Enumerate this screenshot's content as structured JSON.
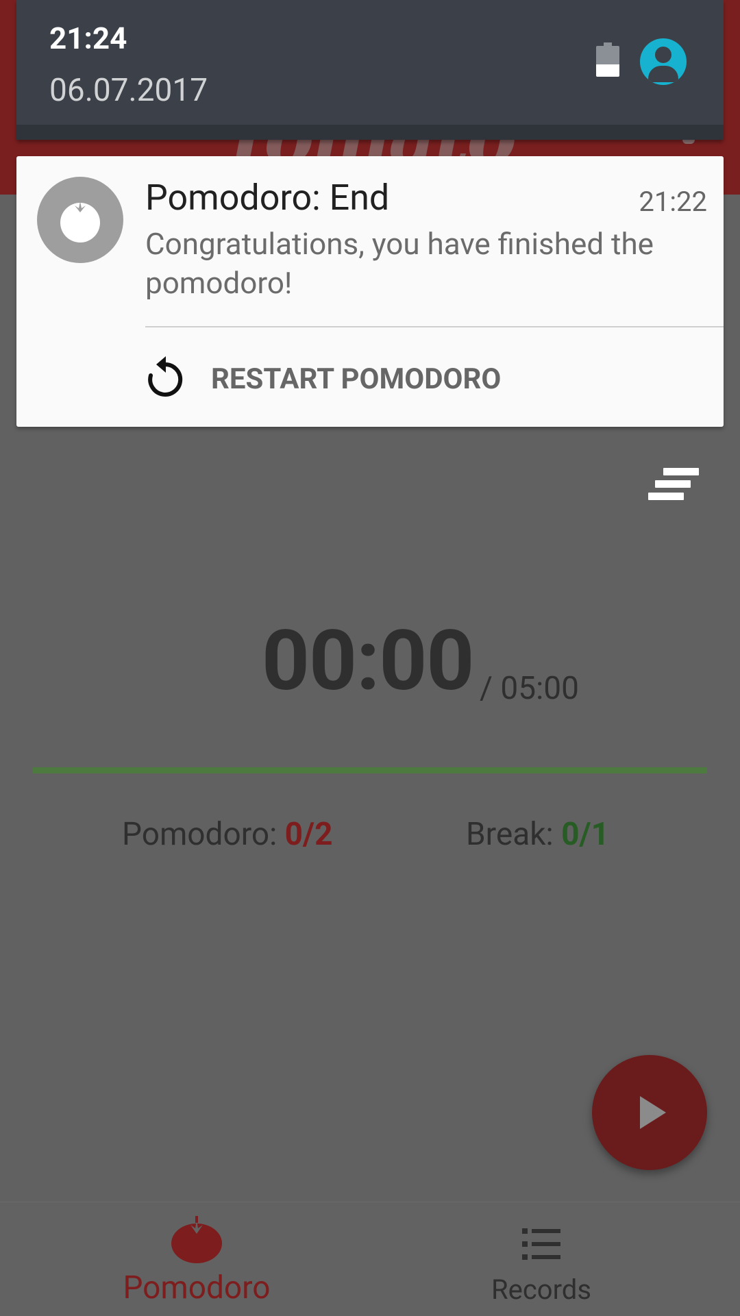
{
  "status_shade": {
    "time": "21:24",
    "date": "06.07.2017",
    "battery_level": 0.4,
    "icons": [
      "battery-icon",
      "account-icon"
    ]
  },
  "notification": {
    "app_icon": "tomato-icon",
    "title": "Pomodoro: End",
    "time": "21:22",
    "message": "Congratulations, you have finished the pomodoro!",
    "action": {
      "label": "RESTART POMODORO",
      "icon": "restart-icon"
    }
  },
  "app": {
    "timer": {
      "elapsed": "00:00",
      "total": "/ 05:00"
    },
    "progress": 1.0,
    "counters": {
      "pomodoro_label": "Pomodoro:",
      "pomodoro_value": "0/2",
      "break_label": "Break:",
      "break_value": "0/1"
    },
    "fab": {
      "icon": "play-icon"
    },
    "bottom_nav": [
      {
        "label": "Pomodoro",
        "icon": "tomato-icon",
        "active": true
      },
      {
        "label": "Records",
        "icon": "list-icon",
        "active": false
      }
    ]
  },
  "colors": {
    "shade": "#3c4149",
    "accent_red": "#7d1d1d",
    "accent_green": "#275c24",
    "avatar": "#17b2cf"
  }
}
